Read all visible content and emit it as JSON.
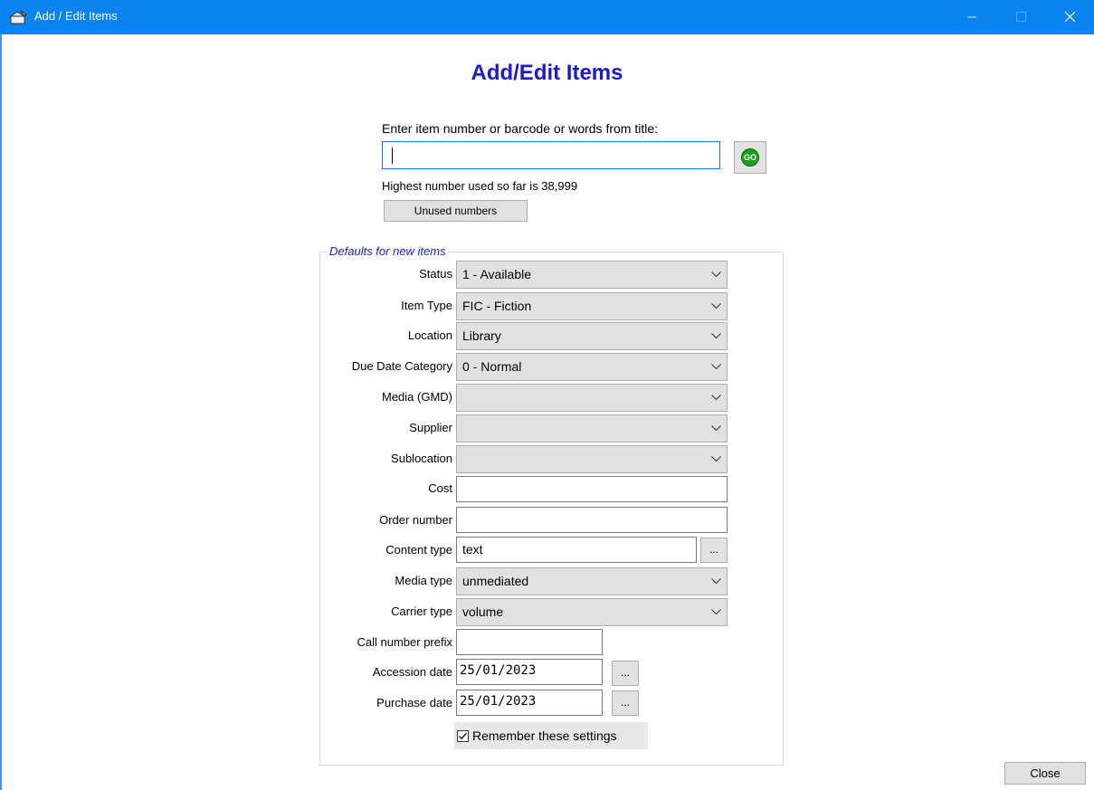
{
  "window": {
    "title": "Add / Edit Items",
    "controls": {
      "minimize": "minimize-icon",
      "maximize": "maximize-icon",
      "close": "close-icon"
    }
  },
  "heading": "Add/Edit Items",
  "search": {
    "prompt": "Enter item number or barcode or words from title:",
    "value": "",
    "go_label": "GO"
  },
  "highest_number_text": "Highest number used so far is 38,999",
  "unused_button": "Unused numbers",
  "defaults": {
    "legend": "Defaults for new items",
    "status": {
      "label": "Status",
      "value": "1 - Available"
    },
    "item_type": {
      "label": "Item Type",
      "value": "FIC - Fiction"
    },
    "location": {
      "label": "Location",
      "value": "Library"
    },
    "due_date_category": {
      "label": "Due Date Category",
      "value": "0 - Normal"
    },
    "media_gmd": {
      "label": "Media (GMD)",
      "value": ""
    },
    "supplier": {
      "label": "Supplier",
      "value": ""
    },
    "sublocation": {
      "label": "Sublocation",
      "value": ""
    },
    "cost": {
      "label": "Cost",
      "value": ""
    },
    "order_number": {
      "label": "Order number",
      "value": ""
    },
    "content_type": {
      "label": "Content type",
      "value": "text",
      "button": "..."
    },
    "media_type": {
      "label": "Media type",
      "value": "unmediated"
    },
    "carrier_type": {
      "label": "Carrier type",
      "value": "volume"
    },
    "call_number_prefix": {
      "label": "Call number prefix",
      "value": ""
    },
    "accession_date": {
      "label": "Accession date",
      "value": "25/01/2023",
      "button": "..."
    },
    "purchase_date": {
      "label": "Purchase date",
      "value": "25/01/2023",
      "button": "..."
    },
    "remember": {
      "label": "Remember these settings",
      "checked": true
    }
  },
  "close_button": "Close",
  "colors": {
    "titlebar": "#0b84f0",
    "heading": "#1a1ad8",
    "go": "#1aa21a"
  }
}
